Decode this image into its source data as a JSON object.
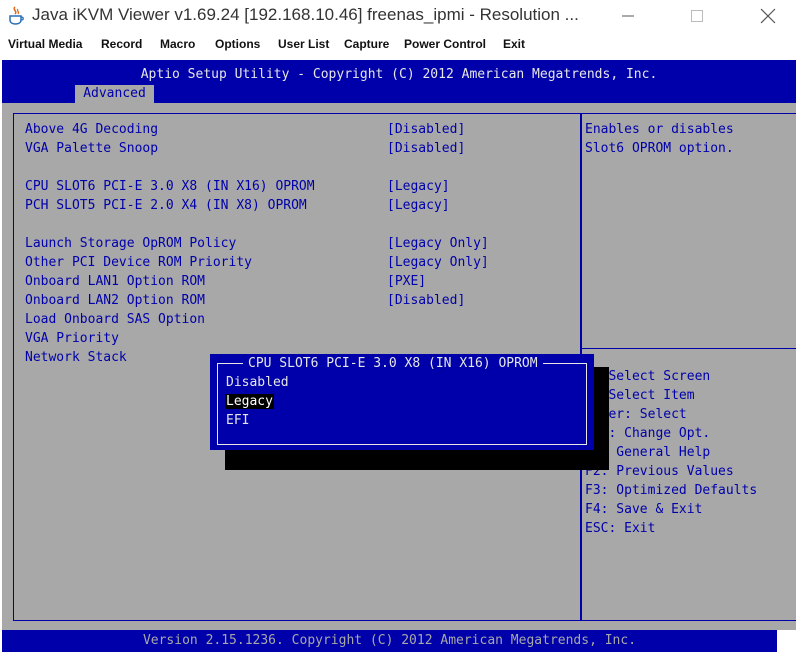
{
  "window": {
    "title": "Java iKVM Viewer v1.69.24 [192.168.10.46] freenas_ipmi - Resolution ...",
    "minimize_icon": "minimize-icon",
    "maximize_icon": "maximize-icon",
    "close_icon": "close-icon"
  },
  "menubar": {
    "items": [
      "Virtual Media",
      "Record",
      "Macro",
      "Options",
      "User List",
      "Capture",
      "Power Control",
      "Exit"
    ]
  },
  "bios": {
    "header_title": "Aptio Setup Utility - Copyright (C) 2012 American Megatrends, Inc.",
    "tab": "Advanced",
    "settings": [
      {
        "label": "Above 4G Decoding",
        "value": "[Disabled]"
      },
      {
        "label": "VGA Palette Snoop",
        "value": "[Disabled]"
      },
      {
        "label": "CPU SLOT6 PCI-E 3.0 X8 (IN X16) OPROM",
        "value": "[Legacy]"
      },
      {
        "label": "PCH SLOT5 PCI-E 2.0 X4 (IN X8) OPROM",
        "value": "[Legacy]"
      },
      {
        "label": "Launch Storage OpROM Policy",
        "value": "[Legacy Only]"
      },
      {
        "label": "Other PCI Device ROM Priority",
        "value": "[Legacy Only]"
      },
      {
        "label": "Onboard LAN1 Option ROM",
        "value": "[PXE]"
      },
      {
        "label": "Onboard LAN2 Option ROM",
        "value": "[Disabled]"
      },
      {
        "label": "Load Onboard SAS Option",
        "value": ""
      },
      {
        "label": "VGA Priority",
        "value": ""
      },
      {
        "label": "Network Stack",
        "value": ""
      }
    ],
    "help_lines": [
      "Enables or disables",
      "Slot6 OPROM option."
    ],
    "key_help": [
      "   Select Screen",
      "   Select Item",
      "   er: Select",
      "+/-: Change Opt.",
      "F1: General Help",
      "F2: Previous Values",
      "F3: Optimized Defaults",
      "F4: Save & Exit",
      "ESC: Exit"
    ],
    "popup": {
      "title": "CPU SLOT6 PCI-E 3.0 X8 (IN X16) OPROM",
      "options": [
        "Disabled",
        "Legacy",
        "EFI"
      ],
      "selected": "Legacy"
    },
    "footer": "Version 2.15.1236. Copyright (C) 2012 American Megatrends, Inc."
  },
  "colors": {
    "bios_blue": "#0000aa",
    "bios_gray": "#a8a8a8",
    "bios_white": "#e6e6e6"
  }
}
